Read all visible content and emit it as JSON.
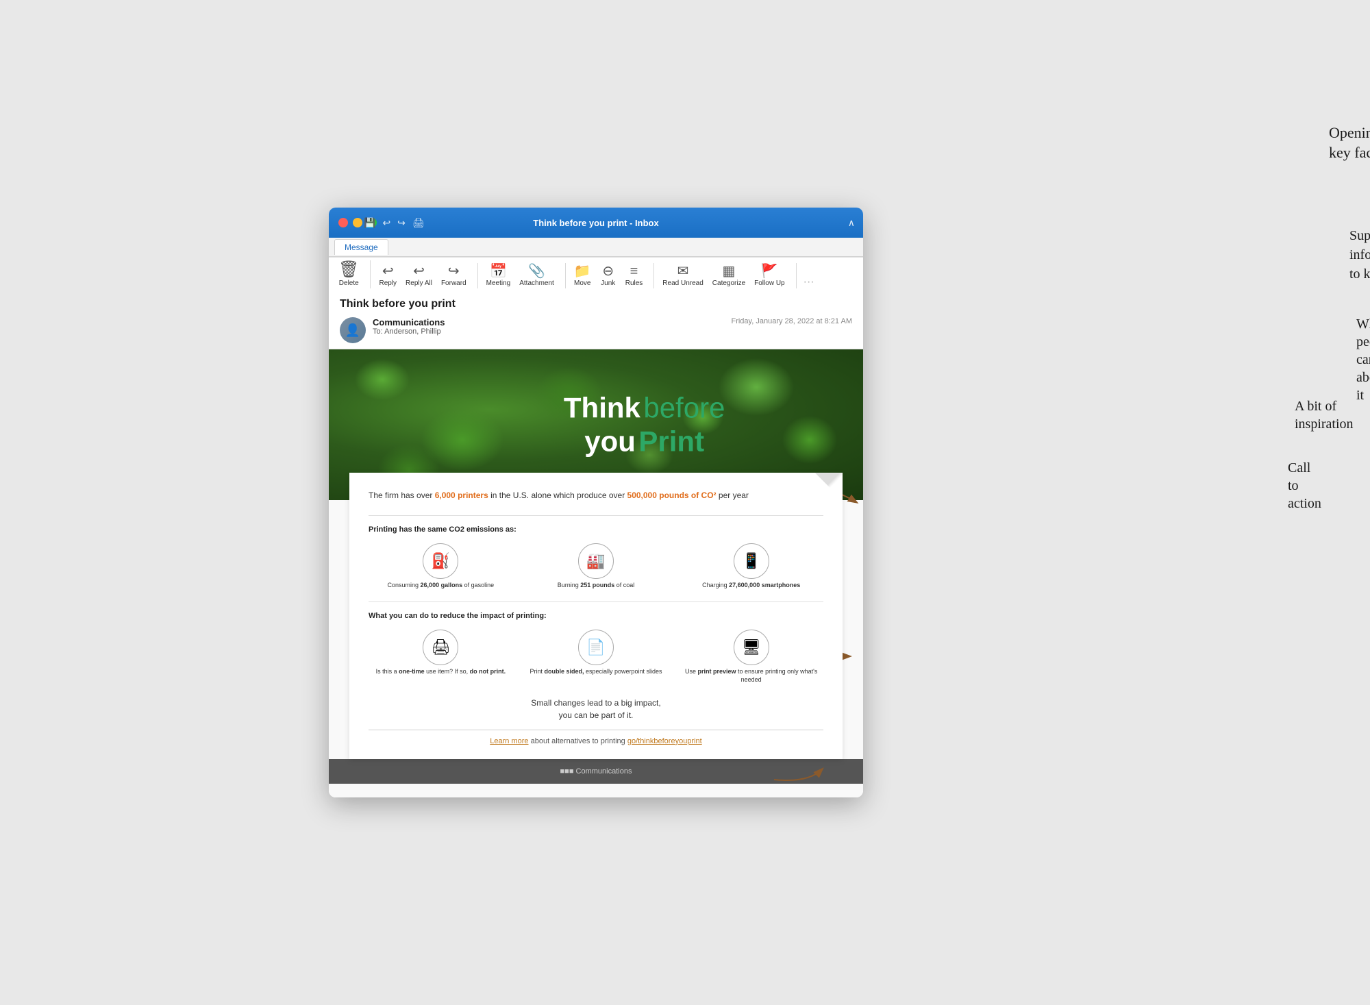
{
  "window": {
    "title": "Think before you print - Inbox",
    "tab": "Message"
  },
  "ribbon": {
    "buttons": [
      {
        "id": "delete",
        "icon": "🗑",
        "label": "Delete"
      },
      {
        "id": "reply",
        "icon": "↩",
        "label": "Reply"
      },
      {
        "id": "reply-all",
        "icon": "↩↩",
        "label": "Reply All"
      },
      {
        "id": "forward",
        "icon": "→",
        "label": "Forward"
      },
      {
        "id": "meeting",
        "icon": "📅",
        "label": "Meeting"
      },
      {
        "id": "attachment",
        "icon": "📎",
        "label": "Attachment"
      },
      {
        "id": "move",
        "icon": "📁",
        "label": "Move"
      },
      {
        "id": "junk",
        "icon": "🚫",
        "label": "Junk"
      },
      {
        "id": "rules",
        "icon": "≡",
        "label": "Rules"
      },
      {
        "id": "read-unread",
        "icon": "✉",
        "label": "Read Unread"
      },
      {
        "id": "categorize",
        "icon": "▦",
        "label": "Categorize"
      },
      {
        "id": "follow-up",
        "icon": "🚩",
        "label": "Follow Up"
      }
    ]
  },
  "email": {
    "subject": "Think before you print",
    "from": "Communications",
    "to": "Anderson, Phillip",
    "date": "Friday, January 28, 2022 at 8:21 AM"
  },
  "hero": {
    "line1_bold": "Think",
    "line1_colored": "before",
    "line2_normal": "you",
    "line2_colored": "Print"
  },
  "content": {
    "key_fact": "The firm has over 6,000 printers in the U.S. alone which produce over 500,000 pounds of CO² per year",
    "co2_section_title": "Printing has the same CO2 emissions as:",
    "co2_items": [
      {
        "icon": "⛽",
        "label": "Consuming 26,000 gallons of gasoline"
      },
      {
        "icon": "🏭",
        "label": "Burning 251 pounds of coal"
      },
      {
        "icon": "📱",
        "label": "Charging 27,600,000 smartphones"
      }
    ],
    "actions_title": "What you can do to reduce the impact of printing:",
    "action_items": [
      {
        "icon": "🖨",
        "label": "Is this a one-time use item? If so, do not print."
      },
      {
        "icon": "📄",
        "label": "Print double sided, especially powerpoint slides"
      },
      {
        "icon": "🖥",
        "label": "Use print preview to ensure printing only what's needed"
      }
    ],
    "inspiration": "Small changes lead to a big impact,\nyou can be part of it.",
    "cta": "Learn more about alternatives to printing go/thinkbeforeyouprint"
  },
  "annotations": {
    "opening_key_fact": "Opening key fact",
    "supporting_info": "Supporting information\nto key fact",
    "what_people_can_do": "What people can do about it",
    "inspiration": "A bit of inspiration",
    "call_to_action": "Call to action"
  }
}
